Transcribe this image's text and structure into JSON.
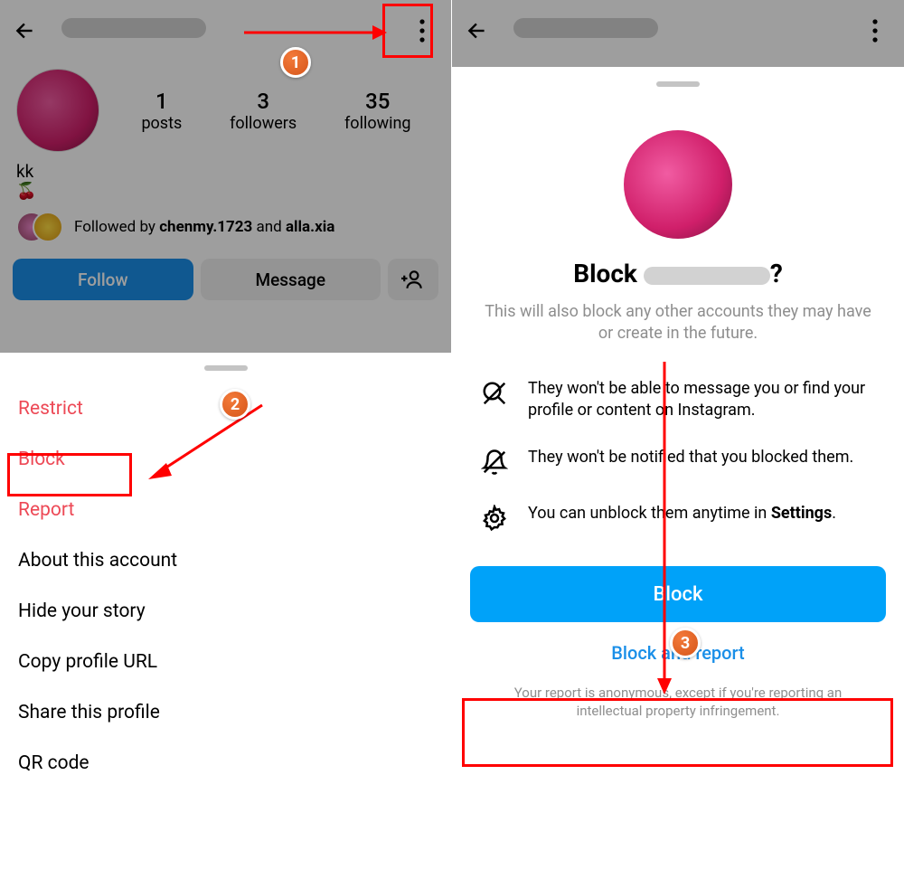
{
  "left": {
    "header": {
      "username_redacted": true
    },
    "stats": {
      "posts": {
        "num": "1",
        "label": "posts"
      },
      "followers": {
        "num": "3",
        "label": "followers"
      },
      "following": {
        "num": "35",
        "label": "following"
      }
    },
    "bio": {
      "name": "kk",
      "emoji": "🍒"
    },
    "followed_by_prefix": "Followed by ",
    "followed_by_1": "chenmy.1723",
    "followed_by_sep": " and ",
    "followed_by_2": "alla.xia",
    "actions": {
      "follow": "Follow",
      "message": "Message"
    },
    "menu": {
      "restrict": "Restrict",
      "block": "Block",
      "report": "Report",
      "about": "About this account",
      "hide": "Hide your story",
      "copy": "Copy profile URL",
      "share": "Share this profile",
      "qr": "QR code"
    }
  },
  "right": {
    "title_prefix": "Block ",
    "title_suffix": "?",
    "subtitle": "This will also block any other accounts they may have or create in the future.",
    "info1": "They won't be able to message you or find your profile or content on Instagram.",
    "info2": "They won't be notified that you blocked them.",
    "info3a": "You can unblock them anytime in ",
    "info3b": "Settings",
    "info3c": ".",
    "block_btn": "Block",
    "block_report": "Block and report",
    "disclaimer": "Your report is anonymous, except if you're reporting an intellectual property infringement."
  },
  "steps": {
    "s1": "1",
    "s2": "2",
    "s3": "3"
  }
}
